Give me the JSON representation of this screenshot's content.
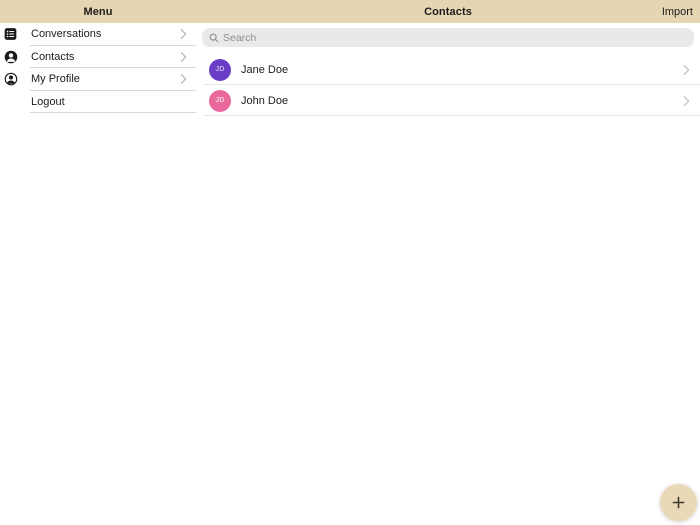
{
  "header": {
    "left_title": "Menu",
    "right_title": "Contacts",
    "import_button": "Import"
  },
  "sidebar": {
    "items": [
      {
        "label": "Conversations",
        "icon": "list-icon"
      },
      {
        "label": "Contacts",
        "icon": "person-circle-icon"
      },
      {
        "label": "My Profile",
        "icon": "person-circle-outline-icon"
      },
      {
        "label": "Logout",
        "icon": null
      }
    ]
  },
  "main": {
    "search": {
      "placeholder": "Search",
      "icon": "search-icon"
    },
    "contacts": [
      {
        "name": "Jane Doe",
        "initials": "JD",
        "avatar_color": "#6a3dc6",
        "initials_color": "#c7b2ec"
      },
      {
        "name": "John Doe",
        "initials": "JD",
        "avatar_color": "#e9699c",
        "initials_color": "#f8cfdf"
      }
    ]
  },
  "fab": {
    "icon": "add-icon",
    "background": "#e9d9b6",
    "plus_color": "#3d382c"
  },
  "colors": {
    "header_bg": "#e6d5b3",
    "text": "#1c1c1c",
    "search_bg": "#e9e9e9",
    "placeholder": "#8f8f8f",
    "chevron": "#c3c3c3"
  }
}
